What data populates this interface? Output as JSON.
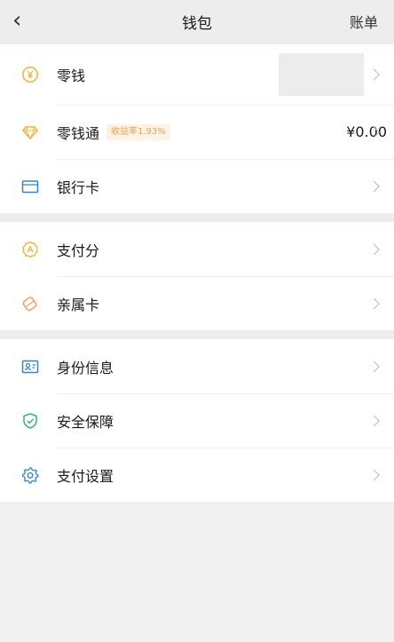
{
  "header": {
    "back_icon": "chevron-left-icon",
    "title": "钱包",
    "right_label": "账单"
  },
  "groups": [
    {
      "items": [
        {
          "label": "零钱",
          "icon": "coin-yuan-icon",
          "icon_color": "#f2b544"
        },
        {
          "label": "零钱通",
          "icon": "diamond-icon",
          "icon_color": "#f2b544",
          "badge": "收益率1.93%",
          "value": "¥0.00"
        },
        {
          "label": "银行卡",
          "icon": "bank-card-icon",
          "icon_color": "#3a83c6"
        }
      ]
    },
    {
      "items": [
        {
          "label": "支付分",
          "icon": "score-badge-icon",
          "icon_color": "#f2b544"
        },
        {
          "label": "亲属卡",
          "icon": "family-card-icon",
          "icon_color": "#e8a360"
        }
      ]
    },
    {
      "items": [
        {
          "label": "身份信息",
          "icon": "id-card-icon",
          "icon_color": "#3a83c6"
        },
        {
          "label": "安全保障",
          "icon": "shield-check-icon",
          "icon_color": "#3cb371"
        },
        {
          "label": "支付设置",
          "icon": "gear-icon",
          "icon_color": "#3a83c6"
        }
      ]
    }
  ],
  "colors": {
    "background": "#ededed",
    "card": "#ffffff",
    "badge_bg": "#fdf3e4",
    "badge_text": "#e4a25a",
    "chevron": "#bdbdbd"
  }
}
